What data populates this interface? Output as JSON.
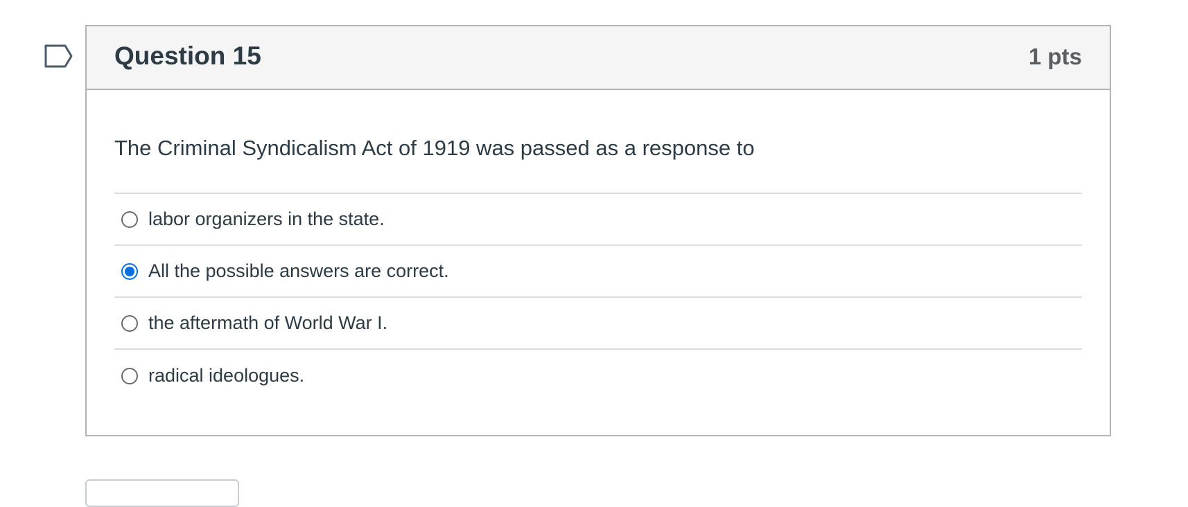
{
  "question": {
    "title": "Question 15",
    "points": "1 pts",
    "text": "The Criminal Syndicalism Act of 1919 was passed as a response to",
    "answers": [
      {
        "label": "labor organizers in the state.",
        "selected": false
      },
      {
        "label": "All the possible answers are correct.",
        "selected": true
      },
      {
        "label": "the aftermath of World War I.",
        "selected": false
      },
      {
        "label": "radical ideologues.",
        "selected": false
      }
    ]
  },
  "icons": {
    "flag": "bookmark-flag-icon"
  },
  "colors": {
    "accent": "#0770e3",
    "header_bg": "#f5f5f5",
    "border": "#b3b3b3",
    "text": "#2d3b45"
  }
}
